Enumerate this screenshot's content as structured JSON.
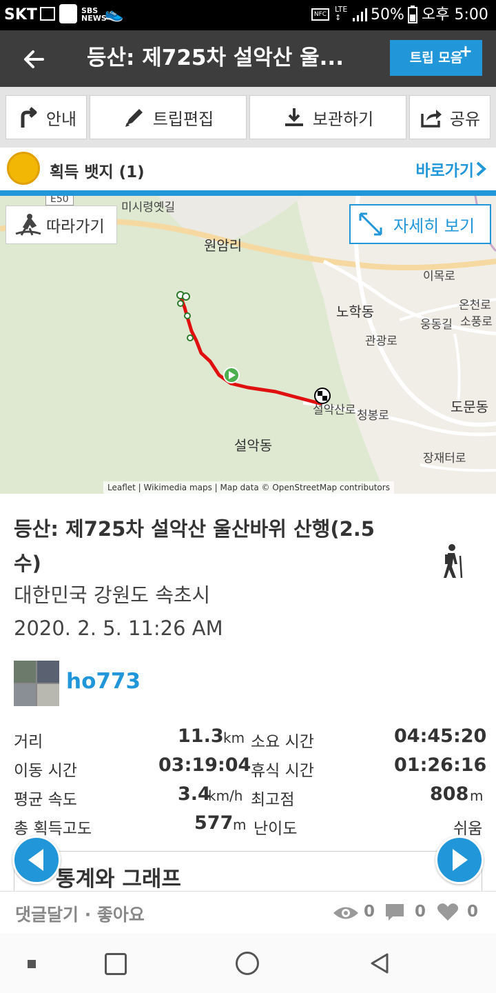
{
  "status_bar": {
    "carrier": "SKT",
    "battery": "50%",
    "time": "오후 5:00"
  },
  "app_bar": {
    "title": "등산: 제725차 설악산 울...",
    "trip_collection_label": "트립 모음"
  },
  "toolbar": {
    "guide_label": "안내",
    "edit_label": "트립편집",
    "save_label": "보관하기",
    "share_label": "공유"
  },
  "badge": {
    "label": "획득 뱃지 (1)",
    "goto_label": "바로가기"
  },
  "map": {
    "follow_label": "따라가기",
    "detail_label": "자세히 보기",
    "place_labels": {
      "wonam": "원암리",
      "nohak": "노학동",
      "seorak": "설악동",
      "domun": "도문동",
      "imok": "이목로",
      "oncheon": "온천로",
      "sopung": "소풍로",
      "gwangwang": "관광로",
      "eungdong": "웅동길",
      "cheongbong": "청봉로",
      "jangjae": "장재터로",
      "seoraksan_ro": "설악산로",
      "misiryeong": "미시령옛길",
      "road_no": "E50"
    },
    "attribution": "Leaflet | Wikimedia maps | Map data © OpenStreetMap contributors"
  },
  "trip": {
    "title": "등산: 제725차 설악산 울산바위 산행(2.5수)",
    "location": "대한민국 강원도 속초시",
    "date": "2020. 2. 5. 11:26 AM",
    "user": "ho773"
  },
  "stats": {
    "distance_label": "거리",
    "distance_value": "11.3",
    "distance_unit": "km",
    "duration_label": "소요 시간",
    "duration_value": "04:45:20",
    "moving_label": "이동 시간",
    "moving_value": "03:19:04",
    "rest_label": "휴식 시간",
    "rest_value": "01:26:16",
    "speed_label": "평균 속도",
    "speed_value": "3.4",
    "speed_unit": "km/h",
    "max_alt_label": "최고점",
    "max_alt_value": "808",
    "max_alt_unit": "m",
    "gain_label": "총 획득고도",
    "gain_value": "577",
    "gain_unit": "m",
    "difficulty_label": "난이도",
    "difficulty_value": "쉬움"
  },
  "graph": {
    "title": "통계와 그래프"
  },
  "bottom": {
    "comment_like": "댓글달기 · 좋아요",
    "views": "0",
    "comments": "0",
    "likes": "0"
  },
  "colors": {
    "accent": "#2196d9",
    "app_bar": "#3d3d3d",
    "track": "#e01010"
  }
}
